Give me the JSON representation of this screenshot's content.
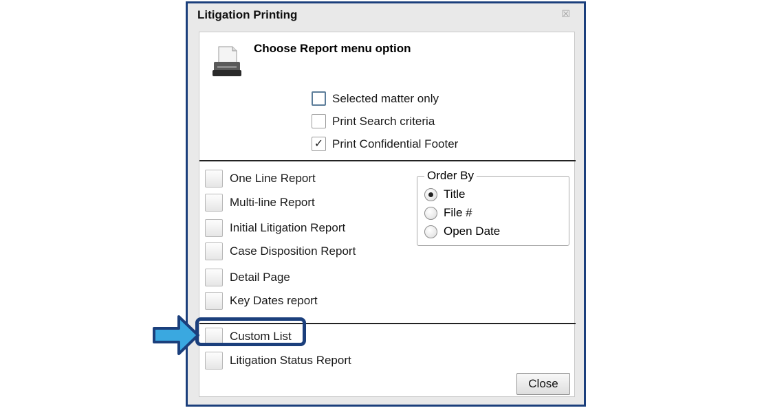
{
  "window": {
    "title": "Litigation Printing",
    "close_glyph": "☒"
  },
  "header": {
    "heading": "Choose Report menu option",
    "icon": "printer-icon"
  },
  "options": [
    {
      "label": "Selected matter only",
      "checked": false
    },
    {
      "label": "Print Search criteria",
      "checked": false
    },
    {
      "label": "Print Confidential Footer",
      "checked": true
    }
  ],
  "reports": [
    {
      "label": "One Line Report"
    },
    {
      "label": "Multi-line Report"
    },
    {
      "label": "Initial Litigation Report"
    },
    {
      "label": "Case Disposition Report"
    },
    {
      "label": "Detail Page"
    },
    {
      "label": "Key Dates report"
    }
  ],
  "order_by": {
    "legend": "Order By",
    "options": [
      {
        "label": "Title",
        "selected": true
      },
      {
        "label": "File #",
        "selected": false
      },
      {
        "label": "Open Date",
        "selected": false
      }
    ]
  },
  "extra_reports": [
    {
      "label": "Custom List"
    },
    {
      "label": "Litigation Status Report"
    }
  ],
  "close_button": {
    "label": "Close"
  },
  "check_glyph": "✓",
  "colors": {
    "border": "#1b3f7c",
    "arrow": "#3aa8e0"
  }
}
